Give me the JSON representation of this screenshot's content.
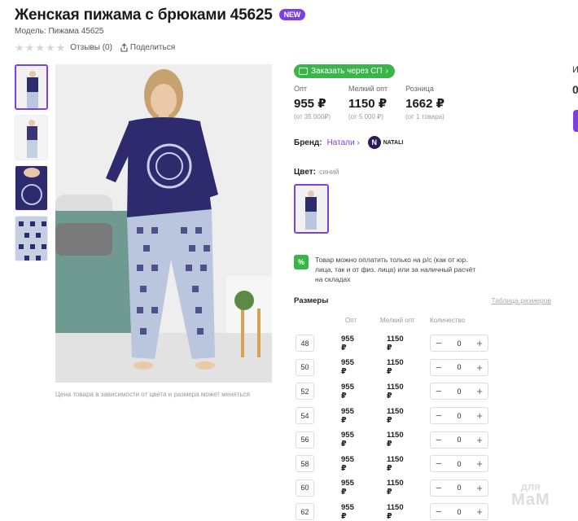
{
  "product": {
    "title": "Женская пижама с брюками 45625",
    "badge": "NEW",
    "model": "Модель: Пижама 45625",
    "reviews": "Отзывы (0)",
    "share": "Поделиться"
  },
  "photo_caption": "Цена товара в зависимости от цвета и размера может меняться",
  "sp_button": "Заказать через СП",
  "prices": [
    {
      "label": "Опт",
      "value": "955 ₽",
      "sub": "(от 35 000₽)"
    },
    {
      "label": "Мелкий опт",
      "value": "1150 ₽",
      "sub": "(от 5 000 ₽)"
    },
    {
      "label": "Розница",
      "value": "1662 ₽",
      "sub": "(от 1 товара)"
    }
  ],
  "brand": {
    "label": "Бренд:",
    "name": "Натали",
    "logo_text": "NATALI"
  },
  "color": {
    "label": "Цвет:",
    "value": "синий"
  },
  "payment_note": "Товар можно оплатить только на р/с (как от юр. лица, так и от физ. лица) или за наличный расчёт на складах",
  "payment_icon": "%",
  "sizes": {
    "title": "Размеры",
    "table_link": "Таблица размеров",
    "col_opt": "Опт",
    "col_small": "Мелкий опт",
    "col_qty": "Количество",
    "rows": [
      {
        "size": "48",
        "opt": "955 ₽",
        "small": "1150 ₽",
        "qty": "0"
      },
      {
        "size": "50",
        "opt": "955 ₽",
        "small": "1150 ₽",
        "qty": "0"
      },
      {
        "size": "52",
        "opt": "955 ₽",
        "small": "1150 ₽",
        "qty": "0"
      },
      {
        "size": "54",
        "opt": "955 ₽",
        "small": "1150 ₽",
        "qty": "0"
      },
      {
        "size": "56",
        "opt": "955 ₽",
        "small": "1150 ₽",
        "qty": "0"
      },
      {
        "size": "58",
        "opt": "955 ₽",
        "small": "1150 ₽",
        "qty": "0"
      },
      {
        "size": "60",
        "opt": "955 ₽",
        "small": "1150 ₽",
        "qty": "0"
      },
      {
        "size": "62",
        "opt": "955 ₽",
        "small": "1150 ₽",
        "qty": "0"
      }
    ]
  },
  "edge": {
    "top": "И",
    "mid": "0"
  },
  "watermark": {
    "line1": "для",
    "line2": "МаМ"
  },
  "colors": {
    "accent": "#7b3fe4",
    "green": "#39b54a",
    "top": "#2e2a6e",
    "pants": "#b9c6dd"
  }
}
